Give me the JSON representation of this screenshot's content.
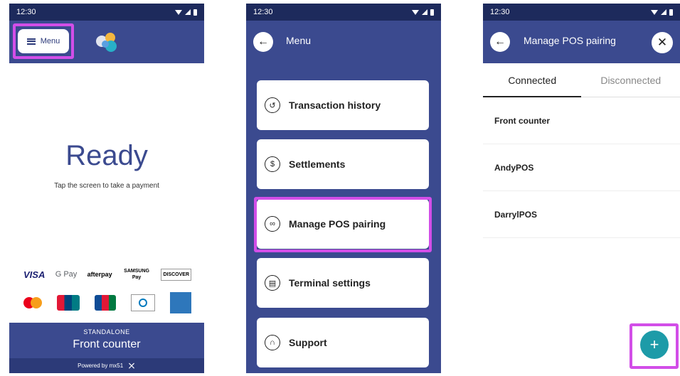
{
  "status": {
    "time": "12:30"
  },
  "phone1": {
    "menu_label": "Menu",
    "ready": "Ready",
    "tap_hint": "Tap the screen to take a payment",
    "cards_row1": [
      "VISA",
      "G Pay",
      "afterpay",
      "SAMSUNG Pay",
      "DISCOVER"
    ],
    "cards_row2": [
      "mastercard",
      "UnionPay",
      "JCB",
      "Diners Club",
      "AMERICAN EXPRESS"
    ],
    "mode": "STANDALONE",
    "terminal_name": "Front counter",
    "powered": "Powered by mx51"
  },
  "phone2": {
    "title": "Menu",
    "items": [
      {
        "label": "Transaction history",
        "icon": "history-icon"
      },
      {
        "label": "Settlements",
        "icon": "settlements-icon"
      },
      {
        "label": "Manage POS pairing",
        "icon": "link-icon"
      },
      {
        "label": "Terminal settings",
        "icon": "terminal-icon"
      },
      {
        "label": "Support",
        "icon": "headset-icon"
      }
    ]
  },
  "phone3": {
    "title": "Manage POS pairing",
    "tabs": [
      "Connected",
      "Disconnected"
    ],
    "rows": [
      "Front counter",
      "AndyPOS",
      "DarrylPOS"
    ],
    "fab": "+"
  },
  "colors": {
    "brand": "#3b4a8f",
    "highlight": "#d24ee8",
    "fab": "#1d9ba8"
  }
}
